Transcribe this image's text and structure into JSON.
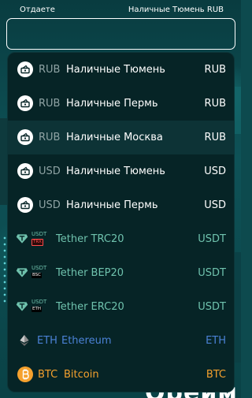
{
  "header": {
    "give_label": "Отдаете",
    "selected_label": "Наличные Тюмень RUB"
  },
  "select": {
    "value": ""
  },
  "options": [
    {
      "code": "RUB",
      "name": "Наличные Тюмень",
      "currency": "RUB",
      "icon": "cash-icon",
      "active": false
    },
    {
      "code": "RUB",
      "name": "Наличные Пермь",
      "currency": "RUB",
      "icon": "cash-icon",
      "active": false
    },
    {
      "code": "RUB",
      "name": "Наличные Москва",
      "currency": "RUB",
      "icon": "cash-icon",
      "active": true
    },
    {
      "code": "USD",
      "name": "Наличные Тюмень",
      "currency": "USD",
      "icon": "cash-icon",
      "active": false
    },
    {
      "code": "USD",
      "name": "Наличные Пермь",
      "currency": "USD",
      "icon": "cash-icon",
      "active": false
    },
    {
      "code": "USDT",
      "network": "TRX",
      "name": "Tether TRC20",
      "currency": "USDT",
      "icon": "tether-icon",
      "active": false
    },
    {
      "code": "USDT",
      "network": "BSC",
      "name": "Tether BEP20",
      "currency": "USDT",
      "icon": "tether-icon",
      "active": false
    },
    {
      "code": "USDT",
      "network": "ETH",
      "name": "Tether ERC20",
      "currency": "USDT",
      "icon": "tether-icon",
      "active": false
    },
    {
      "code": "ETH",
      "name": "Ethereum",
      "currency": "ETH",
      "icon": "ethereum-icon",
      "active": false
    },
    {
      "code": "BTC",
      "name": "Bitcoin",
      "currency": "BTC",
      "icon": "bitcoin-icon",
      "active": false
    }
  ],
  "background": {
    "partial_text": "Ореим"
  },
  "colors": {
    "tether": "#6fc2ad",
    "ethereum": "#4b82d6",
    "bitcoin": "#f5a12e",
    "dropdown_bg": "#062426",
    "active_row": "#0d3336"
  }
}
